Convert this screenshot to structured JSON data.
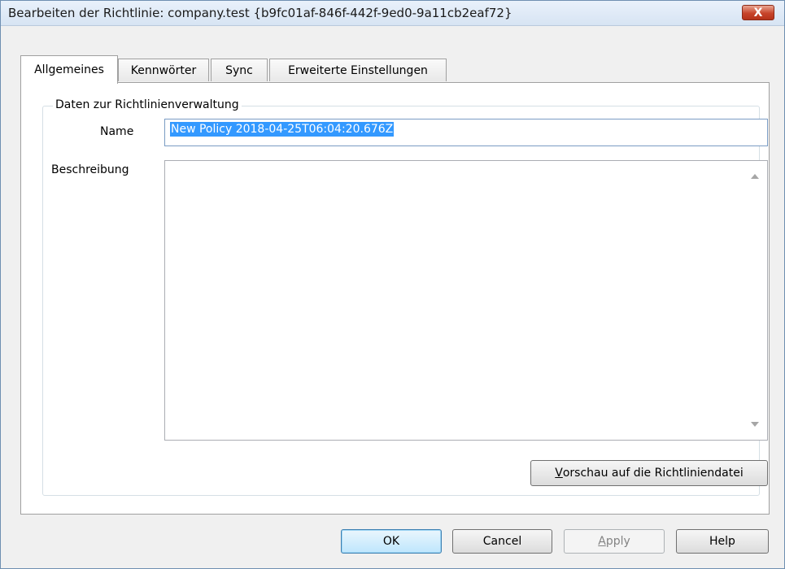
{
  "window": {
    "title": "Bearbeiten der Richtlinie:  company.test {b9fc01af-846f-442f-9ed0-9a11cb2eaf72}",
    "close_label": "X"
  },
  "tabs": [
    {
      "label": "Allgemeines",
      "active": true
    },
    {
      "label": "Kennwörter",
      "active": false
    },
    {
      "label": "Sync",
      "active": false
    },
    {
      "label": "Erweiterte Einstellungen",
      "active": false
    }
  ],
  "group": {
    "legend": "Daten zur Richtlinienverwaltung",
    "name_label": "Name",
    "name_value": "New Policy 2018-04-25T06:04:20.676Z",
    "description_label": "Beschreibung",
    "description_value": "",
    "preview_button": {
      "accel": "V",
      "rest": "orschau auf die Richtliniendatei"
    }
  },
  "buttons": {
    "ok": "OK",
    "cancel": "Cancel",
    "apply": {
      "accel": "A",
      "rest": "pply"
    },
    "help": "Help"
  },
  "colors": {
    "selection": "#3399ff",
    "close_button": "#c7442a"
  }
}
